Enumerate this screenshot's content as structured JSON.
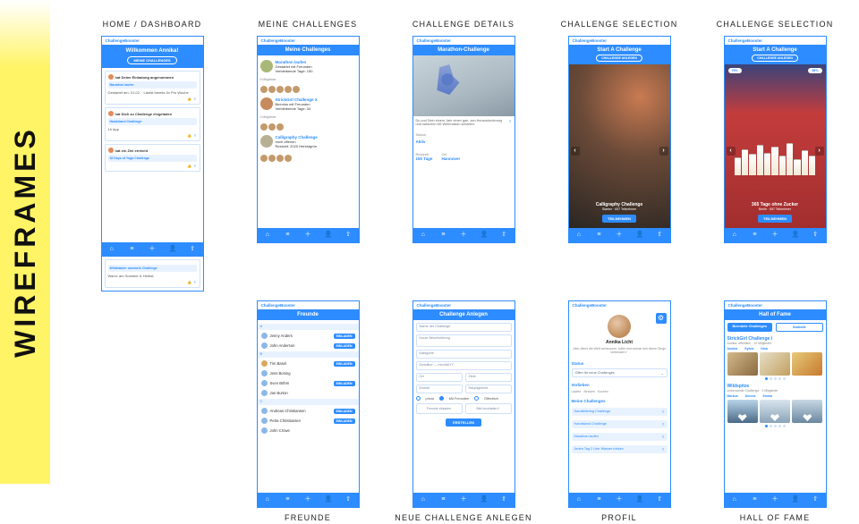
{
  "sidebar_label": "WIREFRAMES",
  "app_name": "ChallengeBooster",
  "nav_icons": [
    "⌂",
    "≡",
    "＋",
    "👤",
    "⇧"
  ],
  "captions": {
    "home": "HOME / DASHBOARD",
    "meine": "MEINE CHALLENGES",
    "details": "CHALLENGE DETAILS",
    "sel1": "CHALLENGE SELECTION",
    "sel2": "CHALLENGE SELECTION",
    "freunde": "FREUNDE",
    "neue": "NEUE CHALLENGE ANLEGEN",
    "profil": "PROFIL",
    "hof": "HALL OF FAME"
  },
  "dashboard": {
    "welcome": "Willkommen Annika!",
    "cta": "MEINE CHALLENGES",
    "feed": [
      {
        "head": "hat Deine Einladung angenommen",
        "sub": "Marathon laufen",
        "body": "Gestartet am: 01.02. · Läufst bereits 5x Pro Woche"
      },
      {
        "head": "hat Dich zu Challenge eingeladen",
        "sub": "Handstand Challenge",
        "body": "1h App"
      },
      {
        "head": "hat ein Ziel erreicht",
        "sub": "30 Days of Yoga Challenge"
      }
    ],
    "extra": {
      "title": "Wildkräuter sammeln Challenge",
      "body": "Wann: am Sommer & Herbst"
    }
  },
  "meine": {
    "title": "Meine Challenges",
    "items": [
      {
        "name": "Marathon laufen",
        "line1": "Gestartet mit Freunden",
        "line2": "Verbleibende Tage: 150",
        "tag": "5 Mitglieder"
      },
      {
        "name": "StrickGirl Challenge X",
        "line1": "Beenlos mit Freunden",
        "line2": "Verbleibende Tage: 34",
        "tag": "3 Mitglieder"
      },
      {
        "name": "Calligraphy Challenge",
        "line1": "noch offenen",
        "line2": "Restzeit: 2020 Herbstgrün",
        "tag": ""
      }
    ]
  },
  "details": {
    "title": "Marathon-Challenge",
    "desc": "Du und Dein einem Jahr einen gan- zen Herausforderung und zwischen Dft Wehrhalvsn schaften.",
    "sec1_label": "Status",
    "sec1_val": "Aktiv",
    "sec2_label": "Restzeit",
    "sec2_val": "150 Tage",
    "sec3_label": "Ort",
    "sec3_val": "Hannover"
  },
  "sel1": {
    "title": "Start A Challenge",
    "pill": "CHALLENGE ANLEGEN",
    "name": "Calligraphy Challenge",
    "sub": "Starten · 657 Teilnehmer",
    "cta": "TEILNEHMEN"
  },
  "sel2": {
    "title": "Start A Challenge",
    "pill": "CHALLENGE ANLEGEN",
    "chip_l": "75%",
    "chip_r": "88%",
    "name": "365 Tage ohne Zucker",
    "sub": "Berlin · 657 Teilnehmer",
    "cta": "TEILNEHMEN"
  },
  "freunde": {
    "title": "Freunde",
    "badge": "EINLADEN",
    "groups": [
      {
        "letter": "A",
        "people": [
          "Jenny Anders",
          "John Anderson"
        ]
      },
      {
        "letter": "B",
        "people": [
          "Tim Basel",
          "Jens Boning",
          "Sven Böhm",
          "Jan Burton"
        ]
      },
      {
        "letter": "C",
        "people": [
          "Andreas Christiansen",
          "Petra Christiansen",
          "John Crowe"
        ]
      }
    ]
  },
  "anlegen": {
    "title": "Challenge Anlegen",
    "fields": {
      "name": "Name der Challenge",
      "desc": "Kurze Beschreibung",
      "category": "Kategorie",
      "deadline": "Deadline — mm/dd/YY",
      "ort": "Ort",
      "ziele": "Ziele",
      "einheit": "Einheit",
      "hauptgericht": "Hauptgericht"
    },
    "radios": {
      "privat": "privat",
      "mit": "Mit Freunden",
      "offentlich": "Öffentlich"
    },
    "uploads": {
      "l": "Freunde einladen",
      "r": "Bild hochladen"
    },
    "submit": "ERSTELLEN"
  },
  "profil": {
    "name": "Annika Licht",
    "quote": "„Wer öfters die Welt verbessern, sollte erst einmal drei kleine Dinge verbessern.\"",
    "status_label": "Status",
    "status_val": "Offen für neue Challenges",
    "vorlieben_label": "Vorlieben",
    "tags": [
      "Laufen",
      "Stricken",
      "Kochen"
    ],
    "mc_label": "Meine Challenges",
    "items": [
      "Handlettering Challenge",
      "Handstand Challenge",
      "Marathon laufen",
      "Jeden Tag 2 Liter Wasser trinken"
    ]
  },
  "hof": {
    "title": "Hall of Fame",
    "tab_l": "Beendete Challenges",
    "tab_r": "Statistik",
    "sec1": {
      "title": "StrickGirl Challenge I",
      "sub": "Annika, öffentlich · 14 Mitglieder",
      "names": [
        "Annika",
        "Sylvia",
        "Nina"
      ]
    },
    "sec2": {
      "title": "Wildspitze",
      "sub": "Unbenannte Challenge · 3 Mitglieder",
      "names": [
        "Markus",
        "Dennis",
        "Emma"
      ]
    }
  }
}
